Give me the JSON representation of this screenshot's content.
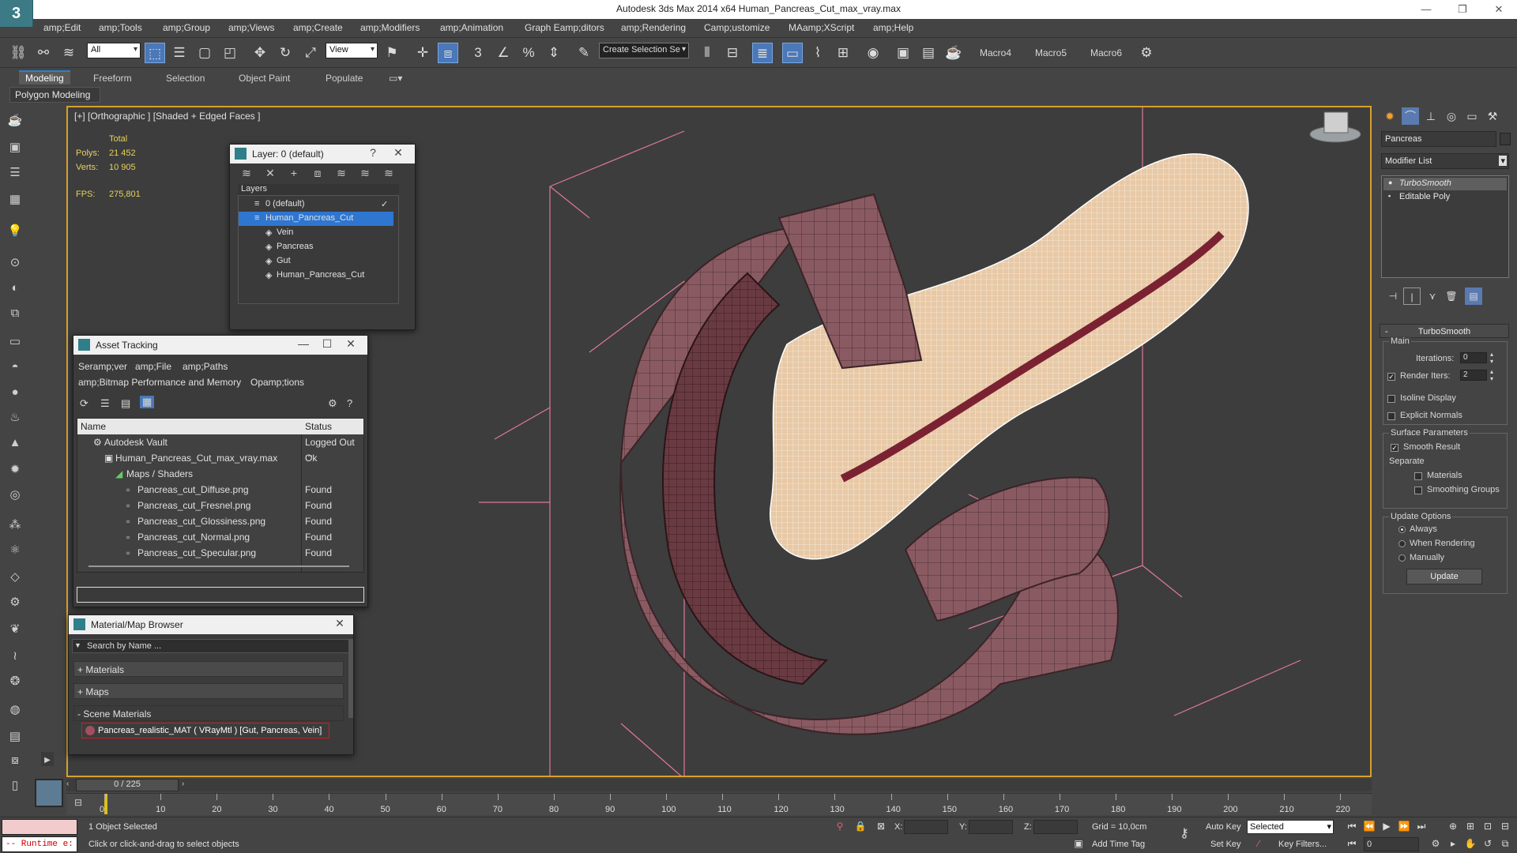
{
  "app": {
    "title": "Autodesk 3ds Max  2014 x64     Human_Pancreas_Cut_max_vray.max"
  },
  "menubar": [
    "amp;Edit",
    "amp;Tools",
    "amp;Group",
    "amp;Views",
    "amp;Create",
    "amp;Modifiers",
    "amp;Animation",
    "Graph Eamp;ditors",
    "amp;Rendering",
    "Camp;ustomize",
    "MAamp;XScript",
    "amp;Help"
  ],
  "toolbar": {
    "filter_select": "All",
    "ref_coord_select": "View",
    "selection_set": "Create Selection Se",
    "macros": [
      "Macro4",
      "Macro5",
      "Macro6"
    ]
  },
  "ribbon": {
    "tabs": [
      "Modeling",
      "Freeform",
      "Selection",
      "Object Paint",
      "Populate"
    ],
    "panel_label": "Polygon Modeling"
  },
  "viewport": {
    "label": "[+] [Orthographic ] [Shaded + Edged Faces ]",
    "stats": {
      "total_label": "Total",
      "polys_label": "Polys:",
      "polys_value": "21 452",
      "verts_label": "Verts:",
      "verts_value": "10 905",
      "fps_label": "FPS:",
      "fps_value": "275,801"
    }
  },
  "layer_panel": {
    "title": "Layer: 0 (default)",
    "help": "?",
    "layers_header": "Layers",
    "rows": [
      "0 (default)",
      "Human_Pancreas_Cut",
      "Vein",
      "Pancreas",
      "Gut",
      "Human_Pancreas_Cut"
    ]
  },
  "asset_panel": {
    "title": "Asset Tracking",
    "menu1": [
      "Seramp;ver",
      "amp;File",
      "amp;Paths"
    ],
    "menu2": [
      "amp;Bitmap Performance and Memory",
      "Opamp;tions"
    ],
    "col_name": "Name",
    "col_status": "Status",
    "rows": [
      {
        "name": "Autodesk Vault",
        "status": "Logged Out ..."
      },
      {
        "name": "Human_Pancreas_Cut_max_vray.max",
        "status": "Ok"
      },
      {
        "name": "Maps / Shaders",
        "status": ""
      },
      {
        "name": "Pancreas_cut_Diffuse.png",
        "status": "Found"
      },
      {
        "name": "Pancreas_cut_Fresnel.png",
        "status": "Found"
      },
      {
        "name": "Pancreas_cut_Glossiness.png",
        "status": "Found"
      },
      {
        "name": "Pancreas_cut_Normal.png",
        "status": "Found"
      },
      {
        "name": "Pancreas_cut_Specular.png",
        "status": "Found"
      }
    ]
  },
  "mat_panel": {
    "title": "Material/Map Browser",
    "search_placeholder": "Search by Name ...",
    "sections": [
      "+ Materials",
      "+ Maps",
      "- Scene Materials"
    ],
    "item": "Pancreas_realistic_MAT  ( VRayMtl )  [Gut, Pancreas, Vein]"
  },
  "command_panel": {
    "object_name": "Pancreas",
    "modifier_list": "Modifier List",
    "stack": [
      "TurboSmooth",
      "Editable Poly"
    ],
    "turbosmooth": {
      "title": "TurboSmooth",
      "main": "Main",
      "iterations_label": "Iterations:",
      "iterations": "0",
      "render_iters_label": "Render Iters:",
      "render_iters": "2",
      "isoline": "Isoline Display",
      "explicit": "Explicit Normals",
      "surface": "Surface Parameters",
      "smooth_result": "Smooth Result",
      "separate": "Separate",
      "materials": "Materials",
      "smoothing_groups": "Smoothing Groups",
      "update_options": "Update Options",
      "always": "Always",
      "when_rendering": "When Rendering",
      "manually": "Manually",
      "update": "Update"
    }
  },
  "timeline": {
    "slider": "0 / 225",
    "ticks": [
      "0",
      "10",
      "20",
      "30",
      "40",
      "50",
      "60",
      "70",
      "80",
      "90",
      "100",
      "110",
      "120",
      "130",
      "140",
      "150",
      "160",
      "170",
      "180",
      "190",
      "200",
      "210",
      "220"
    ]
  },
  "status": {
    "runtime": "-- Runtime e:",
    "selected": "1 Object Selected",
    "prompt": "Click or click-and-drag to select objects",
    "x_label": "X:",
    "y_label": "Y:",
    "z_label": "Z:",
    "grid": "Grid = 10,0cm",
    "add_time_tag": "Add Time Tag",
    "auto_key": "Auto Key",
    "set_key": "Set Key",
    "selected_select": "Selected",
    "key_filters": "Key Filters...",
    "frame": "0"
  },
  "colors": {
    "accent_blue": "#2e76d0",
    "viewport_border": "#d9a02a",
    "stat_yellow": "#e6d15a",
    "mesh_pink": "#8a5a62",
    "mesh_cream": "#e8c9a6"
  }
}
